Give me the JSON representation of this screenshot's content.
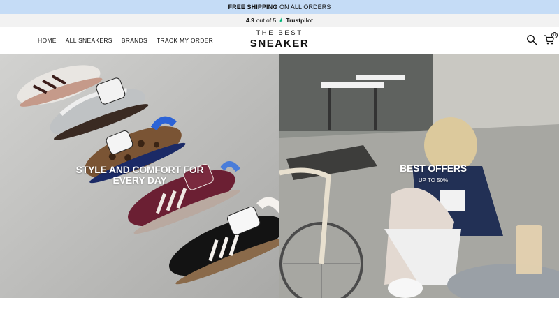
{
  "promo": {
    "bold": "FREE SHIPPING",
    "rest": " ON ALL ORDERS"
  },
  "rating": {
    "score": "4.9",
    "out_of": "out of 5",
    "star": "★",
    "brand": "Trustpilot"
  },
  "nav": {
    "items": [
      "HOME",
      "ALL SNEAKERS",
      "BRANDS",
      "TRACK MY ORDER"
    ]
  },
  "logo": {
    "line1": "THE BEST",
    "line2": "SNEAKER"
  },
  "header": {
    "cart_count": "0",
    "icons": [
      "search-icon",
      "cart-icon"
    ]
  },
  "hero": {
    "left": {
      "headline": "STYLE AND COMFORT FOR EVERY DAY"
    },
    "right": {
      "headline": "BEST OFFERS",
      "sub": "UP TO 50%"
    }
  },
  "colors": {
    "promo_bg": "#c5dcf6",
    "rating_bg": "#f2f2f2",
    "trustpilot_star": "#00b67a"
  }
}
